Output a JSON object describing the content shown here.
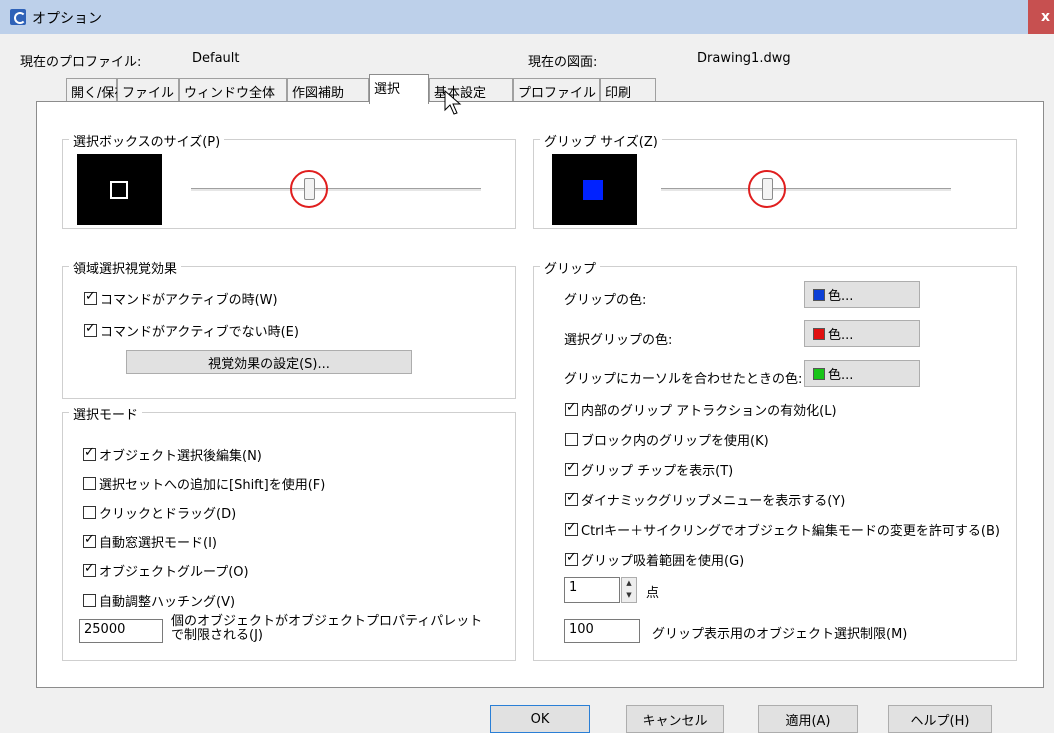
{
  "window": {
    "title": "オプション",
    "close": "x"
  },
  "profile": {
    "label": "現在のプロファイル:",
    "value": "Default"
  },
  "drawing": {
    "label": "現在の図面:",
    "value": "Drawing1.dwg"
  },
  "tabs": [
    "開く/保存",
    "ファイル",
    "ウィンドウ全体",
    "作図補助",
    "選択",
    "基本設定",
    "プロファイル",
    "印刷"
  ],
  "active_tab": "選択",
  "pickbox": {
    "title": "選択ボックスのサイズ(P)"
  },
  "gripsize": {
    "title": "グリップ サイズ(Z)"
  },
  "selection_preview": {
    "title": "領域選択視覚効果",
    "options": [
      {
        "label": "コマンドがアクティブの時(W)",
        "checked": true
      },
      {
        "label": "コマンドがアクティブでない時(E)",
        "checked": true
      }
    ],
    "button": "視覚効果の設定(S)..."
  },
  "selection_modes": {
    "title": "選択モード",
    "options": [
      {
        "label": "オブジェクト選択後編集(N)",
        "checked": true
      },
      {
        "label": "選択セットへの追加に[Shift]を使用(F)",
        "checked": false
      },
      {
        "label": "クリックとドラッグ(D)",
        "checked": false
      },
      {
        "label": "自動窓選択モード(I)",
        "checked": true
      },
      {
        "label": "オブジェクトグループ(O)",
        "checked": true
      },
      {
        "label": "自動調整ハッチング(V)",
        "checked": false
      }
    ],
    "limit_value": "25000",
    "limit_label_line1": "個のオブジェクトがオブジェクトプロパティパレット",
    "limit_label_line2": "で制限される(J)"
  },
  "grips": {
    "title": "グリップ",
    "colors": [
      {
        "label": "グリップの色:",
        "button": "色...",
        "swatch": "#0b3fd6"
      },
      {
        "label": "選択グリップの色:",
        "button": "色...",
        "swatch": "#e01010"
      },
      {
        "label": "グリップにカーソルを合わせたときの色:",
        "button": "色...",
        "swatch": "#18c418"
      }
    ],
    "options": [
      {
        "label": "内部のグリップ アトラクションの有効化(L)",
        "checked": true
      },
      {
        "label": "ブロック内のグリップを使用(K)",
        "checked": false
      },
      {
        "label": "グリップ チップを表示(T)",
        "checked": true
      },
      {
        "label": "ダイナミックグリップメニューを表示する(Y)",
        "checked": true
      },
      {
        "label": "Ctrlキー＋サイクリングでオブジェクト編集モードの変更を許可する(B)",
        "checked": true
      },
      {
        "label": "グリップ吸着範囲を使用(G)",
        "checked": true
      }
    ],
    "points_value": "1",
    "points_label": "点",
    "limit_value": "100",
    "limit_label": "グリップ表示用のオブジェクト選択制限(M)"
  },
  "footer": {
    "ok": "OK",
    "cancel": "キャンセル",
    "apply": "適用(A)",
    "help": "ヘルプ(H)"
  },
  "colors": {
    "titlebar": "#bdd0ea",
    "close": "#c75050",
    "grip_preview": "#0022ff",
    "highlight_ring": "#e01e1e"
  }
}
